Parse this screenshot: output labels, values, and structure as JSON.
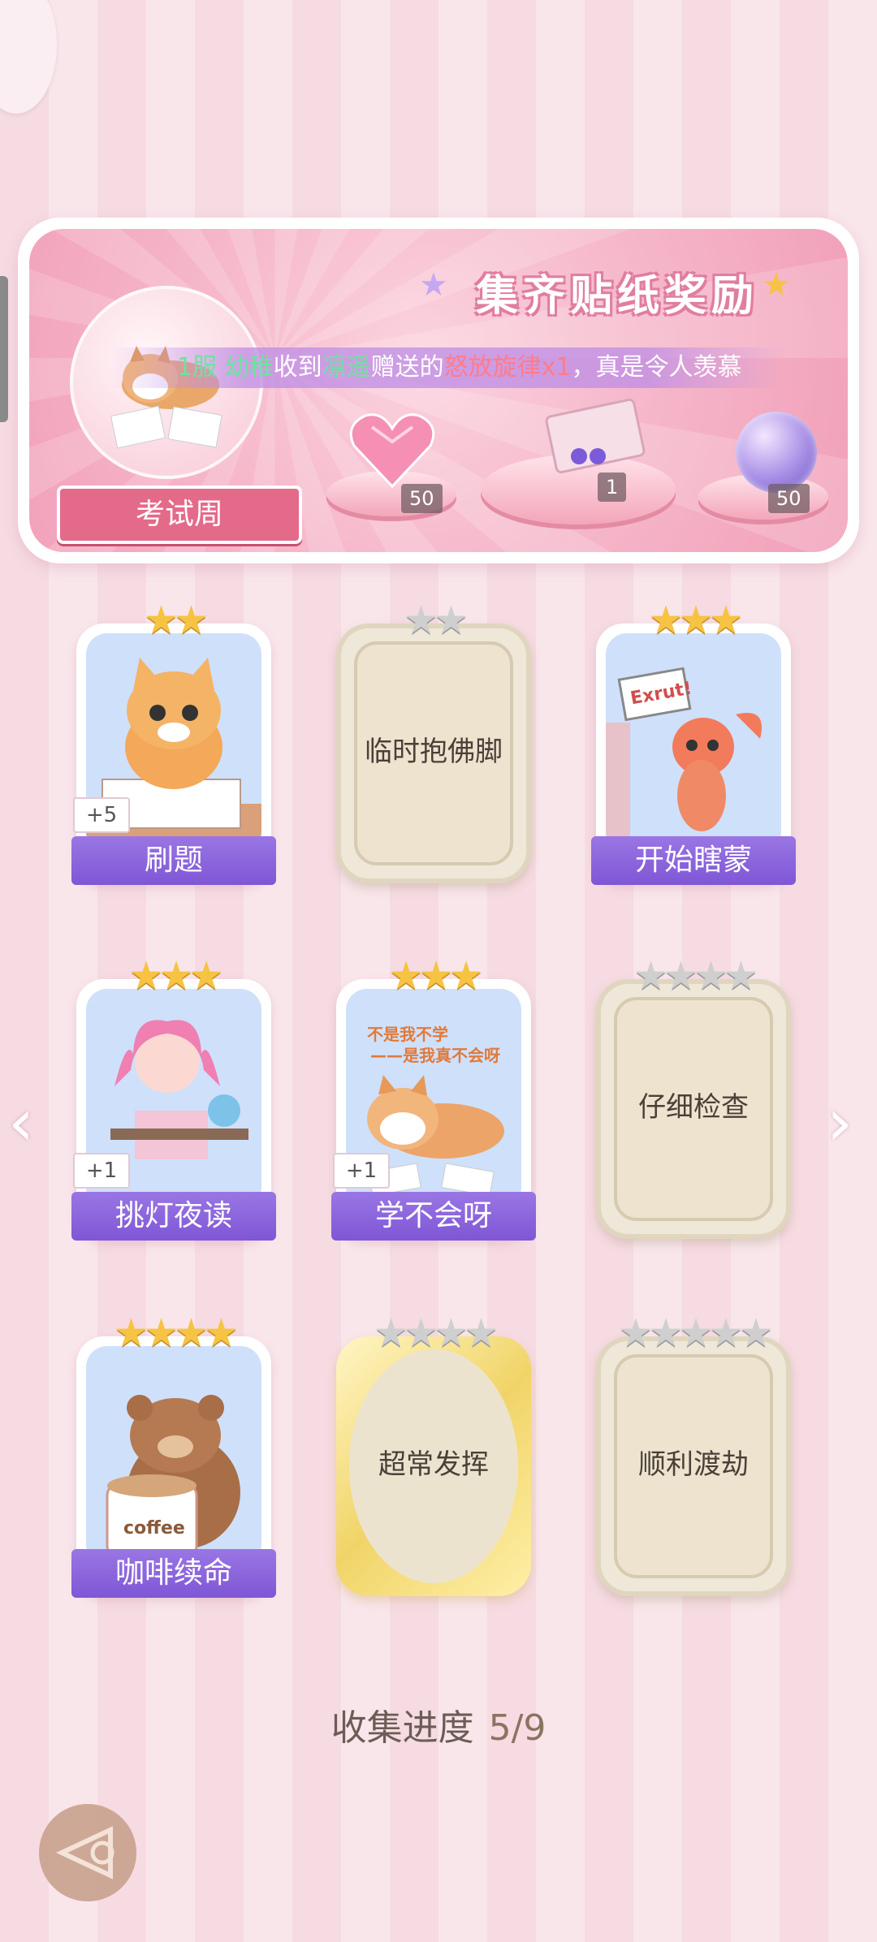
{
  "banner": {
    "title": "集齐贴纸奖励",
    "ticker": {
      "server": "1服",
      "sender_name": "幼稚",
      "text1": "收到",
      "receiver_name": "凛遥",
      "text2": "赠送的",
      "gift": "怒放旋律x1",
      "text3": "，真是令人羡慕"
    },
    "week_label": "考试周",
    "rewards": [
      {
        "icon": "pink-heart-gem-icon",
        "count": "50"
      },
      {
        "icon": "gift-box-icon",
        "count": "1"
      },
      {
        "icon": "purple-orb-icon",
        "count": "50"
      }
    ]
  },
  "cards": [
    {
      "name": "刷题",
      "stars": 2,
      "filled": 2,
      "badge": "+5",
      "state": "collected",
      "art": "cat-writing"
    },
    {
      "name": "临时抱佛脚",
      "stars": 2,
      "filled": 0,
      "state": "locked"
    },
    {
      "name": "开始瞎蒙",
      "stars": 3,
      "filled": 3,
      "state": "collected",
      "art": "shrimp-sign",
      "sign_text": "Exrut!"
    },
    {
      "name": "挑灯夜读",
      "stars": 3,
      "filled": 3,
      "badge": "+1",
      "state": "collected",
      "art": "girl-desk"
    },
    {
      "name": "学不会呀",
      "stars": 3,
      "filled": 3,
      "badge": "+1",
      "state": "collected",
      "art": "shiba",
      "art_text": [
        "不是我不学",
        "——是我真不会呀"
      ]
    },
    {
      "name": "仔细检查",
      "stars": 4,
      "filled": 0,
      "state": "locked"
    },
    {
      "name": "咖啡续命",
      "stars": 4,
      "filled": 4,
      "state": "collected",
      "art": "bear-coffee",
      "art_text": [
        "coffee"
      ]
    },
    {
      "name": "超常发挥",
      "stars": 4,
      "filled": 0,
      "state": "locked-gold"
    },
    {
      "name": "顺利渡劫",
      "stars": 5,
      "filled": 0,
      "state": "locked"
    }
  ],
  "progress": {
    "label": "收集进度",
    "value": "5/9"
  },
  "colors": {
    "accent": "#e46a8a",
    "purple": "#8a62dc",
    "gold": "#f6c343"
  }
}
